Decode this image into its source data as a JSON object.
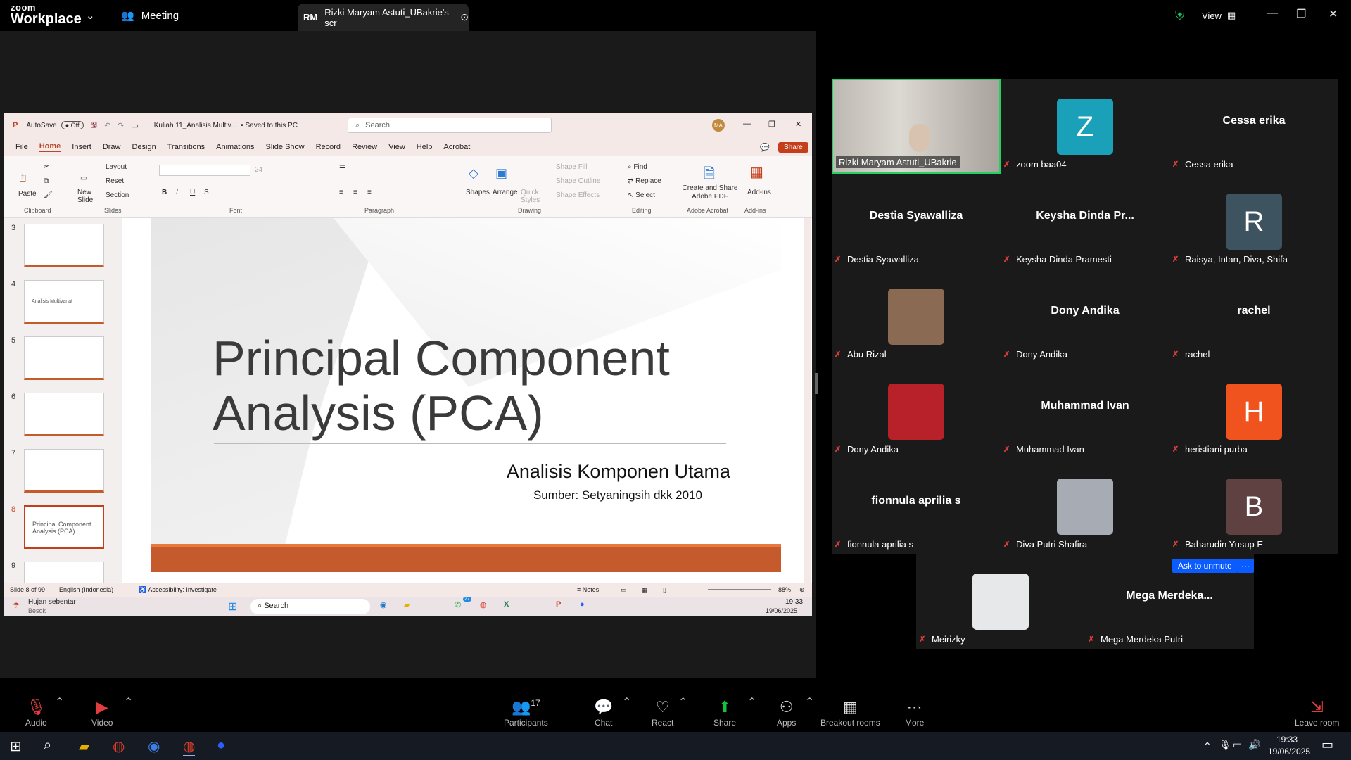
{
  "topbar": {
    "logo_line1": "zoom",
    "logo_line2": "Workplace",
    "meeting_label": "Meeting",
    "share_initials": "RM",
    "share_title": "Rizki Maryam Astuti_UBakrie's scr",
    "view_label": "View"
  },
  "ppt": {
    "autosave_label": "AutoSave",
    "autosave_state": "Off",
    "filename": "Kuliah 11_Analisis Multiv...",
    "saved_status": "• Saved to this PC",
    "search_placeholder": "Search",
    "user_initials": "MA",
    "menu": [
      "File",
      "Home",
      "Insert",
      "Draw",
      "Design",
      "Transitions",
      "Animations",
      "Slide Show",
      "Record",
      "Review",
      "View",
      "Help",
      "Acrobat"
    ],
    "share_button": "Share",
    "ribbon": {
      "paste": "Paste",
      "new_slide": "New Slide",
      "layout": "Layout",
      "reset": "Reset",
      "section": "Section",
      "font_size": "24",
      "shapes": "Shapes",
      "arrange": "Arrange",
      "quick_styles": "Quick Styles",
      "shape_fill": "Shape Fill",
      "shape_outline": "Shape Outline",
      "shape_effects": "Shape Effects",
      "find": "Find",
      "replace": "Replace",
      "select": "Select",
      "create_share_pdf": "Create and Share Adobe PDF",
      "addins": "Add-ins",
      "groups": [
        "Clipboard",
        "Slides",
        "Font",
        "Paragraph",
        "Drawing",
        "Editing",
        "Adobe Acrobat",
        "Add-ins"
      ]
    },
    "thumbnails": [
      {
        "num": "3",
        "text": ""
      },
      {
        "num": "4",
        "text": "Analisis Multivariat"
      },
      {
        "num": "5",
        "text": ""
      },
      {
        "num": "6",
        "text": ""
      },
      {
        "num": "7",
        "text": ""
      },
      {
        "num": "8",
        "text": "Principal Component Analysis (PCA)"
      },
      {
        "num": "9",
        "text": ""
      }
    ],
    "slide": {
      "title": "Principal Component Analysis (PCA)",
      "subtitle": "Analisis Komponen Utama",
      "source": "Sumber: Setyaningsih dkk 2010"
    },
    "status": {
      "slide_info": "Slide 8 of 99",
      "language": "English (Indonesia)",
      "accessibility": "Accessibility: Investigate",
      "notes": "Notes",
      "zoom": "88%"
    },
    "taskbar": {
      "weather": "Hujan sebentar",
      "weather_sub": "Besok",
      "search": "Search",
      "badge": "27",
      "time": "19:33",
      "date": "19/06/2025"
    }
  },
  "gallery": {
    "tiles": [
      {
        "label": "Rizki Maryam Astuti_UBakrie",
        "type": "video",
        "muted": false,
        "active": true
      },
      {
        "label": "zoom baa04",
        "type": "avatar",
        "initial": "Z",
        "color": "#1aa0b8",
        "muted": true
      },
      {
        "label": "Cessa erika",
        "type": "name",
        "display": "Cessa erika",
        "muted": true
      },
      {
        "label": "Destia Syawalliza",
        "type": "name",
        "display": "Destia Syawalliza",
        "muted": true
      },
      {
        "label": "Keysha Dinda Pramesti",
        "type": "name",
        "display": "Keysha Dinda Pr...",
        "muted": true
      },
      {
        "label": "Raisya, Intan, Diva, Shifa",
        "type": "avatar",
        "initial": "R",
        "color": "#3d5360",
        "muted": true
      },
      {
        "label": "Abu Rizal",
        "type": "photo",
        "color": "#8a6a52",
        "muted": true
      },
      {
        "label": "Dony Andika",
        "type": "name",
        "display": "Dony Andika",
        "muted": true
      },
      {
        "label": "rachel",
        "type": "name",
        "display": "rachel",
        "muted": true
      },
      {
        "label": "Dony Andika",
        "type": "photo",
        "color": "#b8202a",
        "muted": true
      },
      {
        "label": "Muhammad Ivan",
        "type": "name",
        "display": "Muhammad Ivan",
        "muted": true
      },
      {
        "label": "heristiani purba",
        "type": "avatar",
        "initial": "H",
        "color": "#f0531d",
        "muted": true
      },
      {
        "label": "fionnula aprilia s",
        "type": "name",
        "display": "fionnula aprilia s",
        "muted": true
      },
      {
        "label": "Diva Putri Shafira",
        "type": "photo",
        "color": "#a7acb4",
        "muted": true
      },
      {
        "label": "Baharudin Yusup E",
        "type": "avatar",
        "initial": "B",
        "color": "#5e4140",
        "muted": true
      },
      {
        "label": "Meirizky",
        "type": "photo",
        "color": "#e7e8ea",
        "muted": true
      },
      {
        "label": "Mega Merdeka Putri",
        "type": "name",
        "display": "Mega Merdeka...",
        "muted": true
      }
    ],
    "ask_unmute": "Ask to unmute",
    "more_dots": "···"
  },
  "toolbar": {
    "audio": "Audio",
    "video": "Video",
    "participants": "Participants",
    "participants_count": "17",
    "chat": "Chat",
    "react": "React",
    "share": "Share",
    "apps": "Apps",
    "breakout": "Breakout rooms",
    "more": "More",
    "leave": "Leave room"
  },
  "wintaskbar": {
    "time": "19:33",
    "date": "19/06/2025"
  },
  "colors": {
    "zoom_green": "#0e8f0e",
    "share_green": "#12c438",
    "ppt_orange": "#c55a2d",
    "muted_red": "#e03e3e",
    "ask_unmute_blue": "#0b5cff"
  }
}
